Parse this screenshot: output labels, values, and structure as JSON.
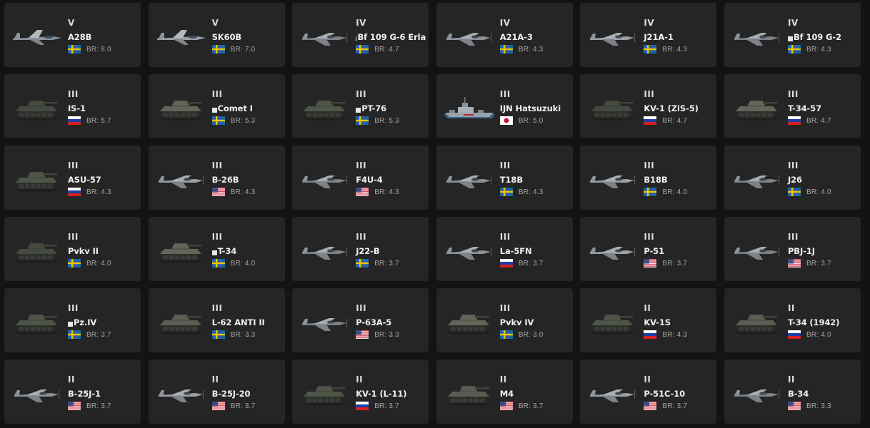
{
  "vehicles": [
    {
      "rank": "V",
      "name": "A28B",
      "br": "BR: 8.0",
      "nation": "sweden",
      "premium": false,
      "type": "plane-jet"
    },
    {
      "rank": "V",
      "name": "SK60B",
      "br": "BR: 7.0",
      "nation": "sweden",
      "premium": false,
      "type": "plane-jet"
    },
    {
      "rank": "IV",
      "name": "Bf 109 G-6 Erla",
      "br": "BR: 4.7",
      "nation": "sweden",
      "premium": true,
      "type": "plane"
    },
    {
      "rank": "IV",
      "name": "A21A-3",
      "br": "BR: 4.3",
      "nation": "sweden",
      "premium": false,
      "type": "plane"
    },
    {
      "rank": "IV",
      "name": "J21A-1",
      "br": "BR: 4.3",
      "nation": "sweden",
      "premium": false,
      "type": "plane"
    },
    {
      "rank": "IV",
      "name": "Bf 109 G-2",
      "br": "BR: 4.3",
      "nation": "sweden",
      "premium": true,
      "type": "plane"
    },
    {
      "rank": "III",
      "name": "IS-1",
      "br": "BR: 5.7",
      "nation": "russia",
      "premium": false,
      "type": "tank"
    },
    {
      "rank": "III",
      "name": "Comet I",
      "br": "BR: 5.3",
      "nation": "sweden",
      "premium": true,
      "type": "tank"
    },
    {
      "rank": "III",
      "name": "PT-76",
      "br": "BR: 5.3",
      "nation": "sweden",
      "premium": true,
      "type": "tank"
    },
    {
      "rank": "III",
      "name": "IJN Hatsuzuki",
      "br": "BR: 5.0",
      "nation": "japan",
      "premium": false,
      "type": "ship"
    },
    {
      "rank": "III",
      "name": "KV-1 (ZiS-5)",
      "br": "BR: 4.7",
      "nation": "russia",
      "premium": false,
      "type": "tank"
    },
    {
      "rank": "III",
      "name": "T-34-57",
      "br": "BR: 4.7",
      "nation": "russia",
      "premium": false,
      "type": "tank"
    },
    {
      "rank": "III",
      "name": "ASU-57",
      "br": "BR: 4.3",
      "nation": "russia",
      "premium": false,
      "type": "tank"
    },
    {
      "rank": "III",
      "name": "B-26B",
      "br": "BR: 4.3",
      "nation": "usa",
      "premium": false,
      "type": "plane"
    },
    {
      "rank": "III",
      "name": "F4U-4",
      "br": "BR: 4.3",
      "nation": "usa",
      "premium": false,
      "type": "plane"
    },
    {
      "rank": "III",
      "name": "T18B",
      "br": "BR: 4.3",
      "nation": "sweden",
      "premium": false,
      "type": "plane"
    },
    {
      "rank": "III",
      "name": "B18B",
      "br": "BR: 4.0",
      "nation": "sweden",
      "premium": false,
      "type": "plane"
    },
    {
      "rank": "III",
      "name": "J26",
      "br": "BR: 4.0",
      "nation": "sweden",
      "premium": false,
      "type": "plane"
    },
    {
      "rank": "III",
      "name": "Pvkv II",
      "br": "BR: 4.0",
      "nation": "sweden",
      "premium": false,
      "type": "tank"
    },
    {
      "rank": "III",
      "name": "T-34",
      "br": "BR: 4.0",
      "nation": "sweden",
      "premium": true,
      "type": "tank"
    },
    {
      "rank": "III",
      "name": "J22-B",
      "br": "BR: 3.7",
      "nation": "sweden",
      "premium": false,
      "type": "plane"
    },
    {
      "rank": "III",
      "name": "La-5FN",
      "br": "BR: 3.7",
      "nation": "russia",
      "premium": false,
      "type": "plane"
    },
    {
      "rank": "III",
      "name": "P-51",
      "br": "BR: 3.7",
      "nation": "usa",
      "premium": false,
      "type": "plane"
    },
    {
      "rank": "III",
      "name": "PBJ-1J",
      "br": "BR: 3.7",
      "nation": "usa",
      "premium": false,
      "type": "plane"
    },
    {
      "rank": "III",
      "name": "Pz.IV",
      "br": "BR: 3.7",
      "nation": "sweden",
      "premium": true,
      "type": "tank"
    },
    {
      "rank": "III",
      "name": "L-62 ANTI II",
      "br": "BR: 3.3",
      "nation": "sweden",
      "premium": false,
      "type": "tank"
    },
    {
      "rank": "III",
      "name": "P-63A-5",
      "br": "BR: 3.3",
      "nation": "usa",
      "premium": false,
      "type": "plane"
    },
    {
      "rank": "III",
      "name": "Pvkv IV",
      "br": "BR: 3.0",
      "nation": "sweden",
      "premium": false,
      "type": "tank"
    },
    {
      "rank": "II",
      "name": "KV-1S",
      "br": "BR: 4.3",
      "nation": "russia",
      "premium": false,
      "type": "tank"
    },
    {
      "rank": "II",
      "name": "T-34 (1942)",
      "br": "BR: 4.0",
      "nation": "russia",
      "premium": false,
      "type": "tank"
    },
    {
      "rank": "II",
      "name": "B-25J-1",
      "br": "BR: 3.7",
      "nation": "usa",
      "premium": false,
      "type": "plane"
    },
    {
      "rank": "II",
      "name": "B-25J-20",
      "br": "BR: 3.7",
      "nation": "usa",
      "premium": false,
      "type": "plane"
    },
    {
      "rank": "II",
      "name": "KV-1 (L-11)",
      "br": "BR: 3.7",
      "nation": "russia",
      "premium": false,
      "type": "tank"
    },
    {
      "rank": "II",
      "name": "M4",
      "br": "BR: 3.7",
      "nation": "usa",
      "premium": false,
      "type": "tank"
    },
    {
      "rank": "II",
      "name": "P-51C-10",
      "br": "BR: 3.7",
      "nation": "usa",
      "premium": false,
      "type": "plane"
    },
    {
      "rank": "II",
      "name": "B-34",
      "br": "BR: 3.3",
      "nation": "usa",
      "premium": false,
      "type": "plane"
    }
  ],
  "colors": {
    "background": "#131313",
    "card": "#252525",
    "text": "#f0f0f0",
    "br_text": "#a5a5a5"
  }
}
